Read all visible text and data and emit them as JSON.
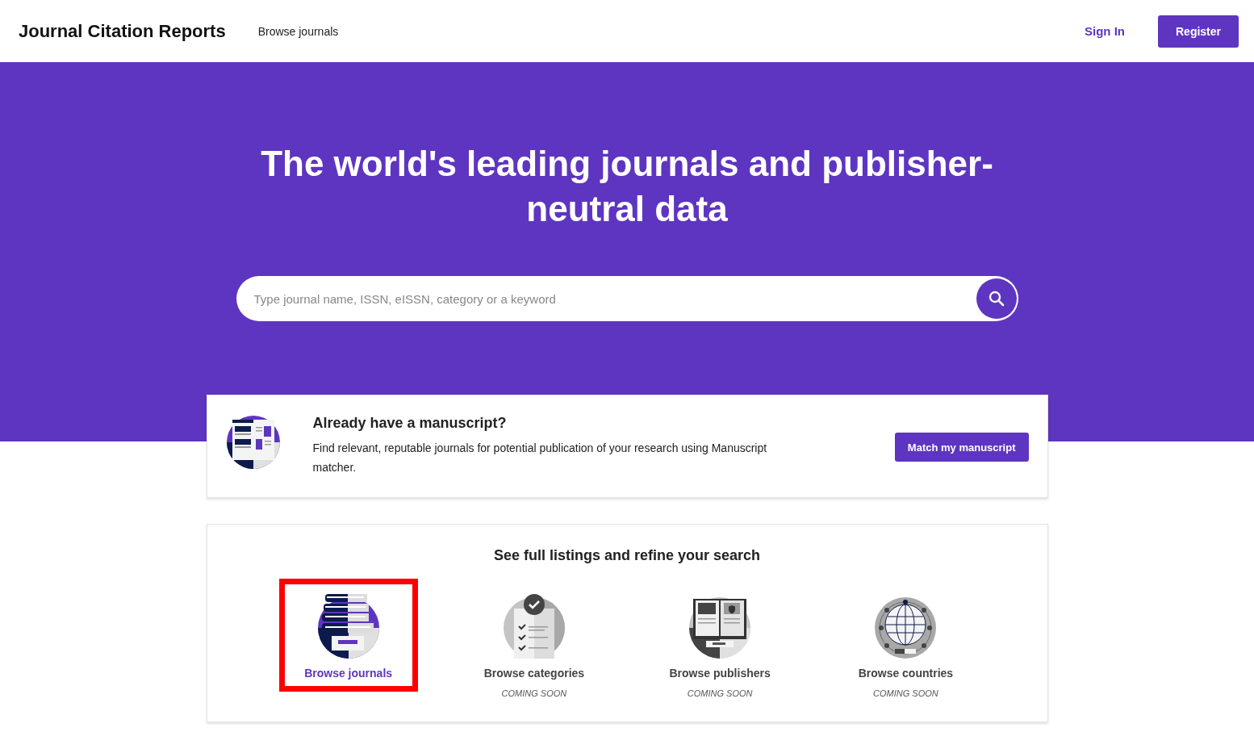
{
  "header": {
    "logo": "Journal Citation Reports",
    "nav": [
      {
        "label": "Browse journals"
      }
    ],
    "sign_in": "Sign In",
    "register": "Register"
  },
  "hero": {
    "title": "The world's leading journals and publisher-neutral data",
    "search": {
      "placeholder": "Type journal name, ISSN, eISSN, category or a keyword"
    }
  },
  "manuscript_card": {
    "title": "Already have a manuscript?",
    "text": "Find relevant, reputable journals for potential publication of your research using Manuscript matcher.",
    "button": "Match my manuscript"
  },
  "browse_card": {
    "title": "See full listings and refine your search",
    "tiles": [
      {
        "kind": "journals",
        "label": "Browse journals",
        "enabled": true,
        "highlighted": true
      },
      {
        "kind": "categories",
        "label": "Browse categories",
        "enabled": false,
        "highlighted": false,
        "note": "COMING SOON"
      },
      {
        "kind": "publishers",
        "label": "Browse publishers",
        "enabled": false,
        "highlighted": false,
        "note": "COMING SOON"
      },
      {
        "kind": "countries",
        "label": "Browse countries",
        "enabled": false,
        "highlighted": false,
        "note": "COMING SOON"
      }
    ]
  }
}
